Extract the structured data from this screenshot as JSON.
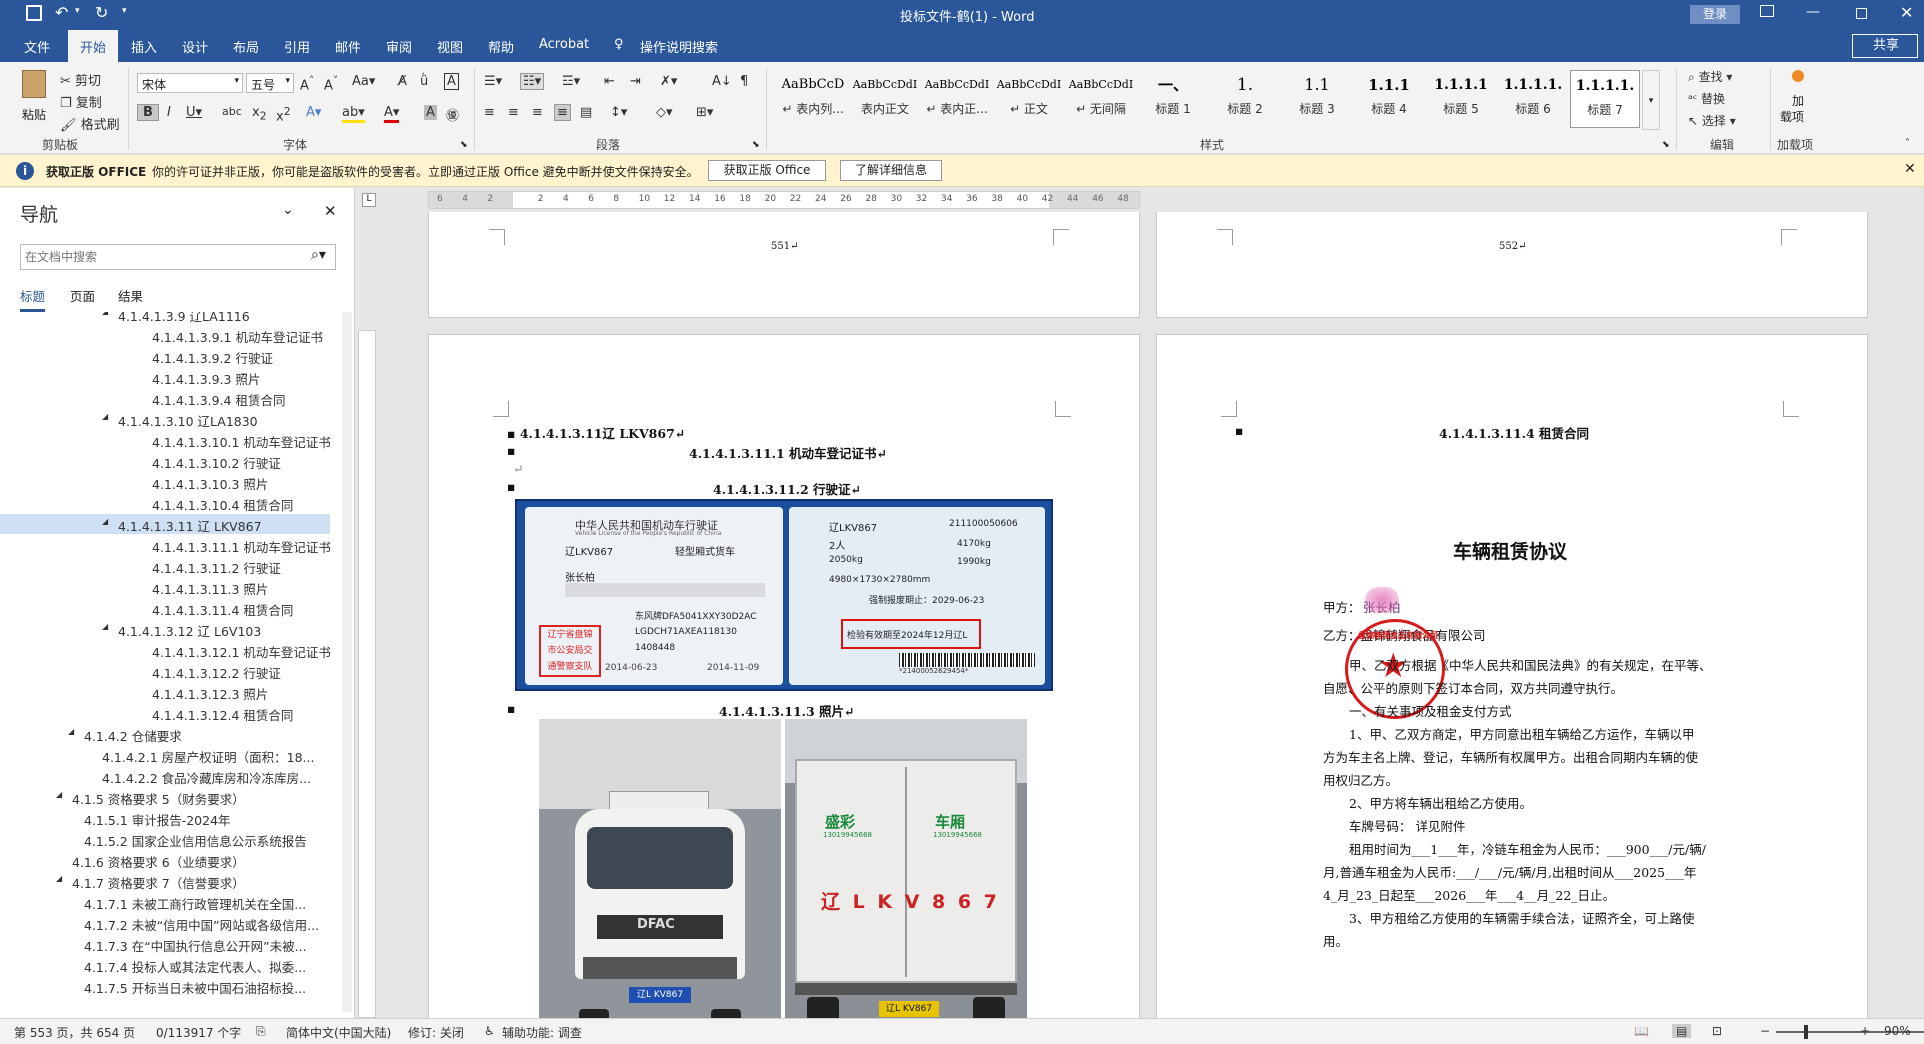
{
  "titlebar": {
    "doc_title": "投标文件-鹤(1)  -  Word",
    "login_label": "登录"
  },
  "menu": {
    "tabs": [
      "文件",
      "开始",
      "插入",
      "设计",
      "布局",
      "引用",
      "邮件",
      "审阅",
      "视图",
      "帮助",
      "Acrobat"
    ],
    "tell_me": "操作说明搜索",
    "share": "共享"
  },
  "ribbon": {
    "clipboard": {
      "paste": "粘贴",
      "cut": "剪切",
      "copy": "复制",
      "format_painter": "格式刷",
      "label": "剪贴板"
    },
    "font": {
      "name": "宋体",
      "size": "五号",
      "label": "字体"
    },
    "paragraph": {
      "label": "段落"
    },
    "styles": {
      "label": "样式",
      "items": [
        {
          "sample": "AaBbCcD",
          "name": "↵ 表内列..."
        },
        {
          "sample": "AaBbCcDdI",
          "name": "表内正文"
        },
        {
          "sample": "AaBbCcDdI",
          "name": "↵ 表内正..."
        },
        {
          "sample": "AaBbCcDdI",
          "name": "↵ 正文"
        },
        {
          "sample": "AaBbCcDdI",
          "name": "↵ 无间隔"
        },
        {
          "sample": "一、",
          "name": "标题 1"
        },
        {
          "sample": "1.",
          "name": "标题 2"
        },
        {
          "sample": "1.1",
          "name": "标题 3"
        },
        {
          "sample": "1.1.1",
          "name": "标题 4"
        },
        {
          "sample": "1.1.1.1",
          "name": "标题 5"
        },
        {
          "sample": "1.1.1.1.",
          "name": "标题 6"
        },
        {
          "sample": "1.1.1.1.",
          "name": "标题 7"
        }
      ]
    },
    "editing": {
      "find": "查找",
      "replace": "替换",
      "select": "选择",
      "label": "编辑"
    },
    "addins": {
      "load": "加载项",
      "top": "加",
      "bottom": "载项",
      "label": "加载项"
    }
  },
  "notice": {
    "title": "获取正版 OFFICE",
    "message": "你的许可证并非正版，你可能是盗版软件的受害者。立即通过正版 Office 避免中断并使文件保持安全。",
    "btn_get": "获取正版 Office",
    "btn_more": "了解详细信息"
  },
  "nav": {
    "title": "导航",
    "search_placeholder": "在文档中搜索",
    "tabs": [
      "标题",
      "页面",
      "结果"
    ],
    "items": [
      {
        "level": 5,
        "text": "4.1.4.1.3.9 辽LA1116",
        "exp": "▲"
      },
      {
        "level": 6,
        "text": "4.1.4.1.3.9.1 机动车登记证书",
        "exp": ""
      },
      {
        "level": 6,
        "text": "4.1.4.1.3.9.2 行驶证",
        "exp": ""
      },
      {
        "level": 6,
        "text": "4.1.4.1.3.9.3 照片",
        "exp": ""
      },
      {
        "level": 6,
        "text": "4.1.4.1.3.9.4 租赁合同",
        "exp": ""
      },
      {
        "level": 5,
        "text": "4.1.4.1.3.10 辽LA1830",
        "exp": "▲"
      },
      {
        "level": 6,
        "text": "4.1.4.1.3.10.1 机动车登记证书",
        "exp": ""
      },
      {
        "level": 6,
        "text": "4.1.4.1.3.10.2 行驶证",
        "exp": ""
      },
      {
        "level": 6,
        "text": "4.1.4.1.3.10.3 照片",
        "exp": ""
      },
      {
        "level": 6,
        "text": "4.1.4.1.3.10.4 租赁合同",
        "exp": ""
      },
      {
        "level": 5,
        "text": "4.1.4.1.3.11 辽 LKV867",
        "exp": "▲",
        "selected": true
      },
      {
        "level": 6,
        "text": "4.1.4.1.3.11.1 机动车登记证书",
        "exp": ""
      },
      {
        "level": 6,
        "text": "4.1.4.1.3.11.2 行驶证",
        "exp": ""
      },
      {
        "level": 6,
        "text": "4.1.4.1.3.11.3 照片",
        "exp": ""
      },
      {
        "level": 6,
        "text": "4.1.4.1.3.11.4 租赁合同",
        "exp": ""
      },
      {
        "level": 5,
        "text": "4.1.4.1.3.12 辽 L6V103",
        "exp": "▲"
      },
      {
        "level": 6,
        "text": "4.1.4.1.3.12.1 机动车登记证书",
        "exp": ""
      },
      {
        "level": 6,
        "text": "4.1.4.1.3.12.2 行驶证",
        "exp": ""
      },
      {
        "level": 6,
        "text": "4.1.4.1.3.12.3 照片",
        "exp": ""
      },
      {
        "level": 6,
        "text": "4.1.4.1.3.12.4 租赁合同",
        "exp": ""
      },
      {
        "level": 3,
        "text": "4.1.4.2 仓储要求",
        "exp": "▲"
      },
      {
        "level": 4,
        "text": "4.1.4.2.1 房屋产权证明（面积：18...",
        "exp": ""
      },
      {
        "level": 4,
        "text": "4.1.4.2.2 食品冷藏库房和冷冻库房...",
        "exp": ""
      },
      {
        "level": 2,
        "text": "4.1.5 资格要求 5（财务要求）",
        "exp": "▲"
      },
      {
        "level": 3,
        "text": "4.1.5.1 审计报告-2024年",
        "exp": ""
      },
      {
        "level": 3,
        "text": "4.1.5.2 国家企业信用信息公示系统报告",
        "exp": ""
      },
      {
        "level": 2,
        "text": "4.1.6 资格要求 6（业绩要求）",
        "exp": ""
      },
      {
        "level": 2,
        "text": "4.1.7 资格要求 7（信誉要求）",
        "exp": "▲"
      },
      {
        "level": 3,
        "text": "4.1.7.1 未被工商行政管理机关在全国...",
        "exp": ""
      },
      {
        "level": 3,
        "text": "4.1.7.2 未被“信用中国”网站或各级信用...",
        "exp": ""
      },
      {
        "level": 3,
        "text": "4.1.7.3 在“中国执行信息公开网”未被...",
        "exp": ""
      },
      {
        "level": 3,
        "text": "4.1.7.4 投标人或其法定代表人、拟委...",
        "exp": ""
      },
      {
        "level": 3,
        "text": "4.1.7.5 开标当日未被中国石油招标投...",
        "exp": ""
      }
    ]
  },
  "ruler": {
    "ticks": [
      "6",
      "4",
      "2",
      "",
      "2",
      "4",
      "6",
      "8",
      "10",
      "12",
      "14",
      "16",
      "18",
      "20",
      "22",
      "24",
      "26",
      "28",
      "30",
      "32",
      "34",
      "36",
      "38",
      "40",
      "42",
      "44",
      "46",
      "48"
    ]
  },
  "pages": {
    "p551": "551↵",
    "p552": "552↵",
    "left": {
      "h1": "4.1.4.1.3.11辽 LKV867↵",
      "h2": "4.1.4.1.3.11.1  机动车登记证书↵",
      "h3": "4.1.4.1.3.11.2  行驶证↵",
      "h4": "4.1.4.1.3.11.3  照片↵",
      "license": {
        "title": "中华人民共和国机动车行驶证",
        "title_en": "Vehicle License of the People's Republic of China",
        "plate": "辽LKV867",
        "vtype": "轻型厢式货车",
        "owner": "张长柏",
        "brand": "东风牌DFA5041XXY30D2AC",
        "vin": "LGDCH71AXEA118130",
        "engine": "1408448",
        "reg_date": "2014-06-23",
        "issue_date": "2014-11-09",
        "stamp_lines": [
          "辽宁省盘锦",
          "市公安局交",
          "通警察支队"
        ],
        "file_no": "211100050606",
        "seats": "2人",
        "weight1": "4170kg",
        "weight2": "2050kg",
        "weight3": "1990kg",
        "dims": "4980×1730×2780mm",
        "scrap": "强制报废期止：2029-06-23",
        "inspect": "检验有效期至2024年12月辽L",
        "barcode_no": "*21400052629454*"
      },
      "truck_left": {
        "plate": "辽L KV867",
        "brand": "DFAC"
      },
      "truck_right": {
        "plate": "辽L KV867",
        "rear_text": "辽 L K V  8 6 7",
        "left_label": "盛彩",
        "right_label": "车厢",
        "phone": "13019945668"
      }
    },
    "right": {
      "heading": "4.1.4.1.3.11.4  租赁合同",
      "title": "车辆租赁协议",
      "party_a_label": "甲方：",
      "party_a": "张长柏",
      "party_b": "乙方：盘锦鹤翔食品有限公司",
      "seal_text": "盘锦鹤翔食品有限公司",
      "lines": [
        "甲、乙双方根据《中华人民共和国民法典》的有关规定，在平等、",
        "自愿、公平的原则下签订本合同，双方共同遵守执行。",
        "一、有关事项及租金支付方式",
        "1、甲、乙双方商定，甲方同意出租车辆给乙方运作，车辆以甲",
        "方为车主名上牌、登记，车辆所有权属甲方。出租合同期内车辆的使",
        "用权归乙方。",
        "2、甲方将车辆出租给乙方使用。",
        "车牌号码：  详见附件",
        "租用时间为___1___年，冷链车租金为人民币：___900___/元/辆/",
        "月,普通车租金为人民币:___/___/元/辆/月,出租时间从___2025___年",
        "4_月_23_日起至___2026___年___4__月_22_日止。",
        "3、甲方租给乙方使用的车辆需手续合法，证照齐全，可上路使",
        "用。"
      ]
    }
  },
  "status": {
    "page": "第 553 页，共 654 页",
    "words": "0/113917 个字",
    "lang": "简体中文(中国大陆)",
    "track": "修订: 关闭",
    "access": "辅助功能: 调查",
    "zoom": "90%"
  }
}
